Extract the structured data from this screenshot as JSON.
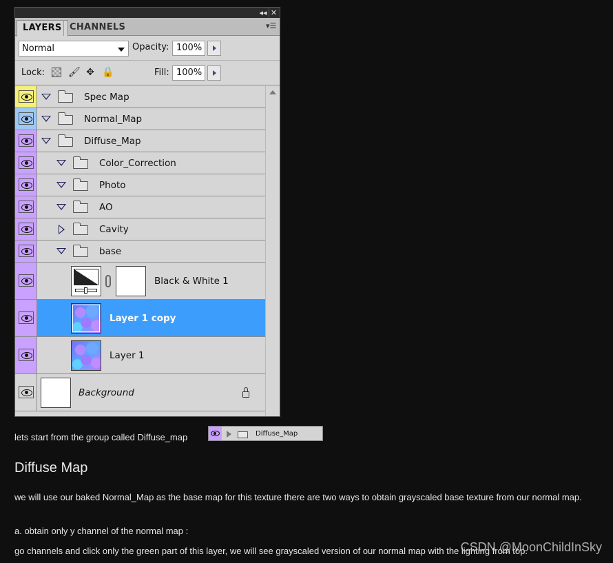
{
  "panel": {
    "tabs": [
      "LAYERS",
      "CHANNELS"
    ],
    "blend_mode": "Normal",
    "opacity_label": "Opacity:",
    "opacity_value": "100%",
    "lock_label": "Lock:",
    "fill_label": "Fill:",
    "fill_value": "100%"
  },
  "layers": [
    {
      "name": "Spec Map",
      "eye_color": "#f5f07a",
      "type": "group",
      "expanded": true,
      "depth": 0
    },
    {
      "name": "Normal_Map",
      "eye_color": "#9cc8f5",
      "type": "group",
      "expanded": true,
      "depth": 0
    },
    {
      "name": "Diffuse_Map",
      "eye_color": "#c9a1ff",
      "type": "group",
      "expanded": true,
      "depth": 0
    },
    {
      "name": "Color_Correction",
      "eye_color": "#c9a1ff",
      "type": "group",
      "expanded": true,
      "depth": 1
    },
    {
      "name": "Photo",
      "eye_color": "#c9a1ff",
      "type": "group",
      "expanded": true,
      "depth": 1
    },
    {
      "name": "AO",
      "eye_color": "#c9a1ff",
      "type": "group",
      "expanded": true,
      "depth": 1
    },
    {
      "name": "Cavity",
      "eye_color": "#c9a1ff",
      "type": "group",
      "expanded": false,
      "depth": 1
    },
    {
      "name": "base",
      "eye_color": "#c9a1ff",
      "type": "group",
      "expanded": true,
      "depth": 1
    },
    {
      "name": "Black & White 1",
      "eye_color": "#c9a1ff",
      "type": "adjustment"
    },
    {
      "name": "Layer 1 copy",
      "eye_color": "#c9a1ff",
      "type": "texture",
      "selected": true
    },
    {
      "name": "Layer 1",
      "eye_color": "#c9a1ff",
      "type": "texture"
    },
    {
      "name": "Background",
      "eye_color": "#d6d6d6",
      "type": "background",
      "locked": true
    }
  ],
  "article": {
    "intro": "lets start from the group called Diffuse_map",
    "inline_group_name": "Diffuse_Map",
    "heading": "Diffuse Map",
    "p1": "we will use our baked Normal_Map as the base map for this texture  there are two ways to obtain grayscaled base texture from our normal map.",
    "p2": "a. obtain only y channel of the normal map :",
    "p3": "go  channels and click only the green part of this layer, we will see grayscaled version of our normal map with the lighting from top."
  },
  "watermark": "CSDN @MoonChildInSky",
  "colors": {
    "page_bg": "#0f0f0f",
    "selection": "#3d9dfd",
    "diffuse_tag": "#c9a1ff",
    "spec_tag": "#f5f07a",
    "normal_tag": "#9cc8f5"
  }
}
